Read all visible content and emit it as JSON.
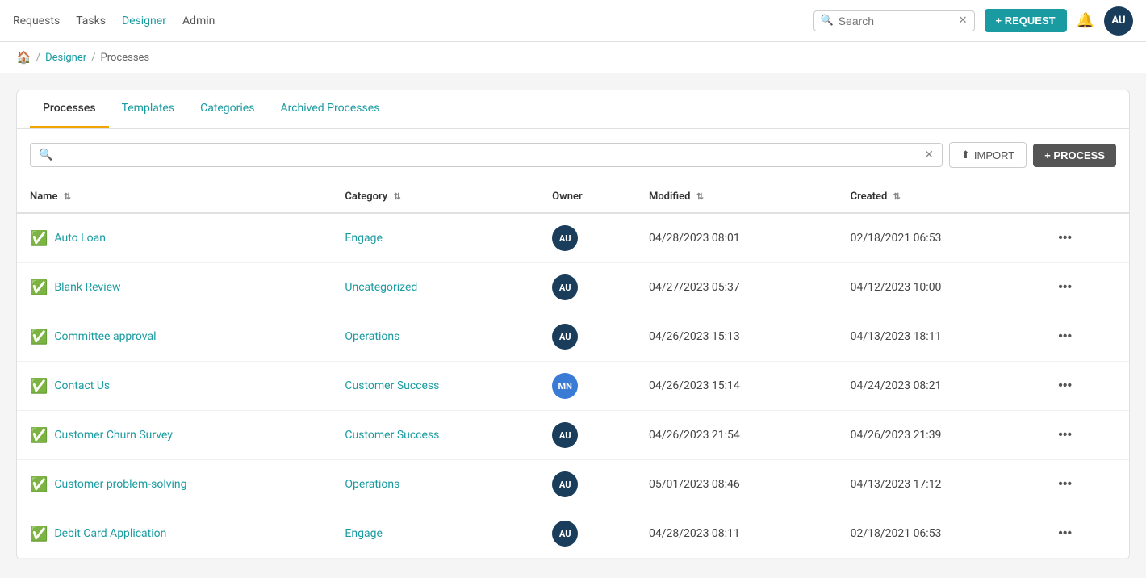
{
  "nav": {
    "links": [
      {
        "label": "Requests",
        "active": false
      },
      {
        "label": "Tasks",
        "active": false
      },
      {
        "label": "Designer",
        "active": true
      },
      {
        "label": "Admin",
        "active": false
      }
    ],
    "search_placeholder": "Search",
    "request_button": "+ REQUEST",
    "avatar_initials": "AU"
  },
  "breadcrumb": {
    "home_icon": "🏠",
    "items": [
      {
        "label": "Designer",
        "link": true
      },
      {
        "label": "Processes",
        "link": false
      }
    ]
  },
  "tabs": [
    {
      "label": "Processes",
      "active": true
    },
    {
      "label": "Templates",
      "active": false
    },
    {
      "label": "Categories",
      "active": false
    },
    {
      "label": "Archived Processes",
      "active": false
    }
  ],
  "toolbar": {
    "search_placeholder": "",
    "import_label": "IMPORT",
    "process_label": "+ PROCESS"
  },
  "table": {
    "columns": [
      {
        "label": "Name",
        "sortable": true
      },
      {
        "label": "Category",
        "sortable": true
      },
      {
        "label": "Owner",
        "sortable": false
      },
      {
        "label": "Modified",
        "sortable": true
      },
      {
        "label": "Created",
        "sortable": true
      }
    ],
    "rows": [
      {
        "name": "Auto Loan",
        "category": "Engage",
        "owner_initials": "AU",
        "owner_type": "au",
        "modified": "04/28/2023 08:01",
        "created": "02/18/2021 06:53"
      },
      {
        "name": "Blank Review",
        "category": "Uncategorized",
        "owner_initials": "AU",
        "owner_type": "au",
        "modified": "04/27/2023 05:37",
        "created": "04/12/2023 10:00"
      },
      {
        "name": "Committee approval",
        "category": "Operations",
        "owner_initials": "AU",
        "owner_type": "au",
        "modified": "04/26/2023 15:13",
        "created": "04/13/2023 18:11"
      },
      {
        "name": "Contact Us",
        "category": "Customer Success",
        "owner_initials": "MN",
        "owner_type": "mn",
        "modified": "04/26/2023 15:14",
        "created": "04/24/2023 08:21"
      },
      {
        "name": "Customer Churn Survey",
        "category": "Customer Success",
        "owner_initials": "AU",
        "owner_type": "au",
        "modified": "04/26/2023 21:54",
        "created": "04/26/2023 21:39"
      },
      {
        "name": "Customer problem-solving",
        "category": "Operations",
        "owner_initials": "AU",
        "owner_type": "au",
        "modified": "05/01/2023 08:46",
        "created": "04/13/2023 17:12"
      },
      {
        "name": "Debit Card Application",
        "category": "Engage",
        "owner_initials": "AU",
        "owner_type": "au",
        "modified": "04/28/2023 08:11",
        "created": "02/18/2021 06:53"
      }
    ]
  }
}
